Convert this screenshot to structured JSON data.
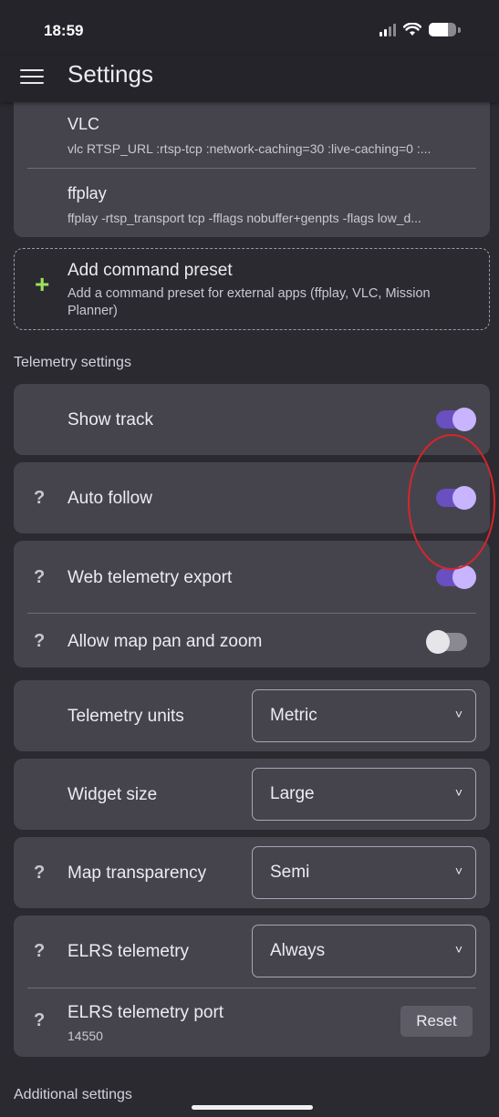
{
  "status": {
    "time": "18:59",
    "battery_level": 0.7
  },
  "appbar": {
    "title": "Settings"
  },
  "presets": [
    {
      "title": "VLC",
      "command": "vlc RTSP_URL :rtsp-tcp :network-caching=30 :live-caching=0 :..."
    },
    {
      "title": "ffplay",
      "command": "ffplay -rtsp_transport tcp -fflags nobuffer+genpts -flags low_d..."
    }
  ],
  "add_preset": {
    "icon": "plus-icon",
    "title": "Add command preset",
    "subtitle": "Add a command preset for external apps (ffplay, VLC, Mission Planner)"
  },
  "telemetry_section": {
    "label": "Telemetry settings"
  },
  "help_glyph": "?",
  "toggles": {
    "show_track": {
      "label": "Show track",
      "on": true
    },
    "auto_follow": {
      "label": "Auto follow",
      "on": true
    },
    "web_export": {
      "label": "Web telemetry export",
      "on": true
    },
    "map_pan_zoom": {
      "label": "Allow map pan and zoom",
      "on": false
    }
  },
  "selects": {
    "units": {
      "label": "Telemetry units",
      "value": "Metric"
    },
    "widget_size": {
      "label": "Widget size",
      "value": "Large"
    },
    "map_transparency": {
      "label": "Map transparency",
      "value": "Semi"
    },
    "elrs": {
      "label": "ELRS telemetry",
      "value": "Always"
    }
  },
  "chevron_glyph": "˅",
  "elrs_port": {
    "label": "ELRS telemetry port",
    "value": "14550",
    "reset_label": "Reset"
  },
  "additional_section": {
    "label": "Additional settings"
  },
  "colors": {
    "accent": "#c8b4ff",
    "track_on": "#6a4fc0",
    "plus": "#9be15d",
    "annotation": "#d6262b"
  }
}
